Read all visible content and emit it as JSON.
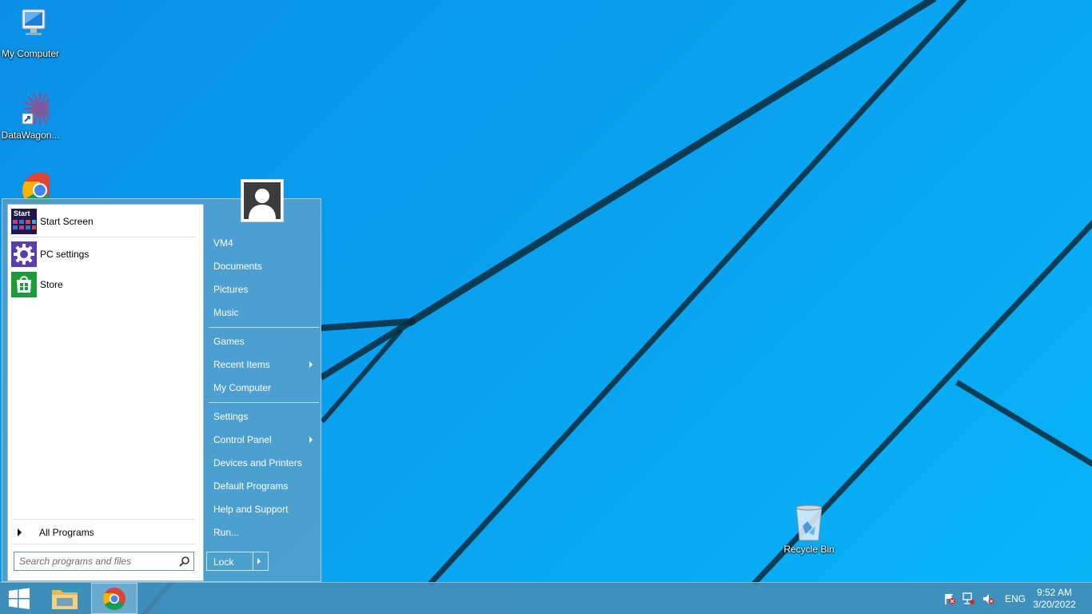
{
  "desktop": {
    "icons": [
      {
        "label": "My Computer",
        "icon": "computer-icon"
      },
      {
        "label": "DataWagon...",
        "icon": "datawagon-icon"
      },
      {
        "label": "",
        "icon": "chrome-icon"
      },
      {
        "label": "Recycle Bin",
        "icon": "recycle-bin-icon"
      }
    ]
  },
  "start_menu": {
    "pinned": [
      {
        "label": "Start Screen",
        "icon": "start-screen-icon"
      },
      {
        "label": "PC settings",
        "icon": "gear-icon"
      },
      {
        "label": "Store",
        "icon": "store-icon"
      }
    ],
    "start_tile_text": "Start",
    "all_programs": "All Programs",
    "search": {
      "placeholder": "Search programs and files",
      "value": ""
    },
    "user_picture": "user-avatar-icon",
    "right_items": [
      {
        "label": "VM4"
      },
      {
        "label": "Documents"
      },
      {
        "label": "Pictures"
      },
      {
        "label": "Music"
      },
      {
        "label": "Games"
      },
      {
        "label": "Recent Items",
        "submenu": true
      },
      {
        "label": "My Computer"
      },
      {
        "label": "Settings"
      },
      {
        "label": "Control Panel",
        "submenu": true
      },
      {
        "label": "Devices and Printers"
      },
      {
        "label": "Default Programs"
      },
      {
        "label": "Help and Support"
      },
      {
        "label": "Run..."
      }
    ],
    "lock_button": "Lock"
  },
  "taskbar": {
    "buttons": [
      {
        "name": "start-button",
        "icon": "windows-logo-icon"
      },
      {
        "name": "file-explorer-button",
        "icon": "folder-icon"
      },
      {
        "name": "chrome-button",
        "icon": "chrome-icon",
        "active": true
      }
    ],
    "tray": {
      "icons": [
        "action-center-flag-icon",
        "network-icon",
        "volume-muted-icon"
      ],
      "language": "ENG",
      "time": "9:52 AM",
      "date": "3/20/2022"
    }
  },
  "colors": {
    "wallpaper": "#0aa0ee",
    "start_menu_bg": "#5fa0c8",
    "taskbar_bg": "#468cb4"
  }
}
